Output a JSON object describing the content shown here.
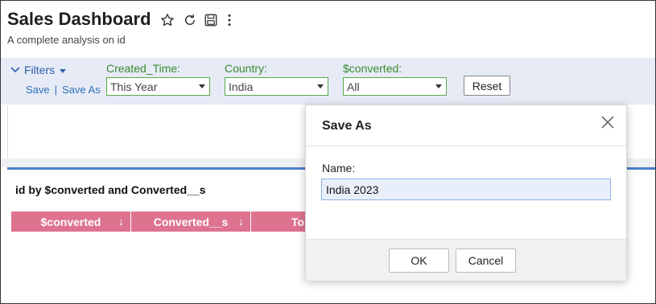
{
  "header": {
    "title": "Sales Dashboard",
    "subtitle": "A complete analysis on id",
    "icons": [
      "star-icon",
      "refresh-icon",
      "save-icon",
      "more-vertical-icon"
    ]
  },
  "filters": {
    "toggle_label": "Filters",
    "save_label": "Save",
    "separator": "|",
    "save_as_label": "Save As",
    "created_time": {
      "label": "Created_Time:",
      "value": "This Year"
    },
    "country": {
      "label": "Country:",
      "value": "India"
    },
    "converted": {
      "label": "$converted:",
      "value": "All"
    },
    "reset_label": "Reset"
  },
  "report": {
    "title": "id by $converted and Converted__s",
    "columns": [
      {
        "label": "$converted",
        "sort": "↓"
      },
      {
        "label": "Converted__s",
        "sort": "↓"
      },
      {
        "label": "To",
        "sort": ""
      }
    ]
  },
  "modal": {
    "title": "Save As",
    "name_label": "Name:",
    "name_value": "India 2023",
    "ok_label": "OK",
    "cancel_label": "Cancel"
  },
  "colors": {
    "filter_bar_bg": "#e6ebf6",
    "filter_label": "#3c8a2e",
    "link": "#2f6fb8",
    "table_header": "#de7390",
    "accent_line": "#4a7fc8"
  }
}
